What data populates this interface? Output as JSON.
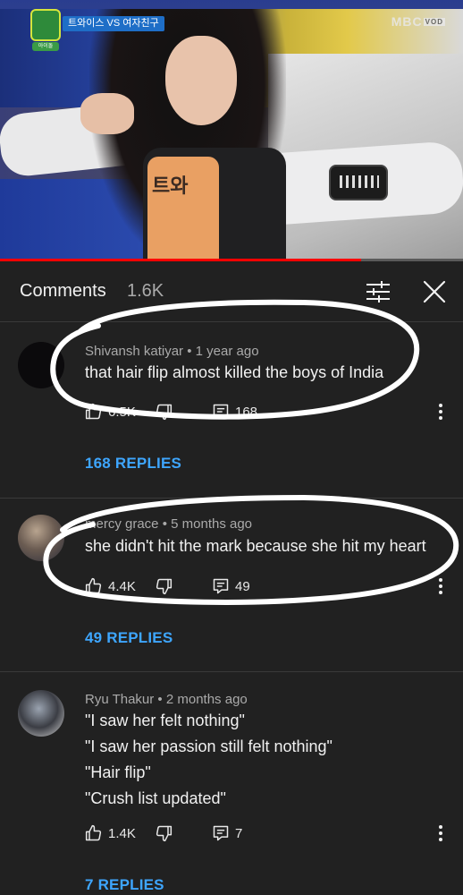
{
  "video": {
    "tag_text": "트와이스 VS 여자친구",
    "badge_sub": "아이돌",
    "broadcaster": "MBC",
    "broadcaster_sub": "VOD",
    "bib_text": "트와",
    "progress_fraction": 0.78
  },
  "comments_header": {
    "title": "Comments",
    "count": "1.6K",
    "filter_icon": "sliders-icon",
    "close_icon": "close-icon"
  },
  "comments": [
    {
      "author": "Shivansh katiyar",
      "time": "1 year ago",
      "lines": [
        "that hair flip almost killed the boys of India"
      ],
      "likes": "6.5K",
      "reply_count": "168",
      "replies_label": "168 REPLIES",
      "avatar_color": "#0b0a0c"
    },
    {
      "author": "mercy grace",
      "time": "5 months ago",
      "lines": [
        "she didn't hit the mark because she hit my heart"
      ],
      "likes": "4.4K",
      "reply_count": "49",
      "replies_label": "49 REPLIES",
      "avatar_color": "#6b5c52"
    },
    {
      "author": "Ryu Thakur",
      "time": "2 months ago",
      "lines": [
        "\"I saw her felt nothing\"",
        "\"I saw her passion still felt nothing\"",
        "\"Hair flip\"",
        "\"Crush list updated\""
      ],
      "likes": "1.4K",
      "reply_count": "7",
      "replies_label": "7 REPLIES",
      "avatar_color": "#3b3d44"
    }
  ],
  "icons": {
    "like": "thumbs-up-icon",
    "dislike": "thumbs-down-icon",
    "reply": "reply-icon",
    "menu": "more-vertical-icon"
  },
  "colors": {
    "background": "#212121",
    "link": "#3ea6ff",
    "secondary_text": "#aaaaaa",
    "progress": "#ff0000",
    "annotation_ink": "#ffffff"
  }
}
